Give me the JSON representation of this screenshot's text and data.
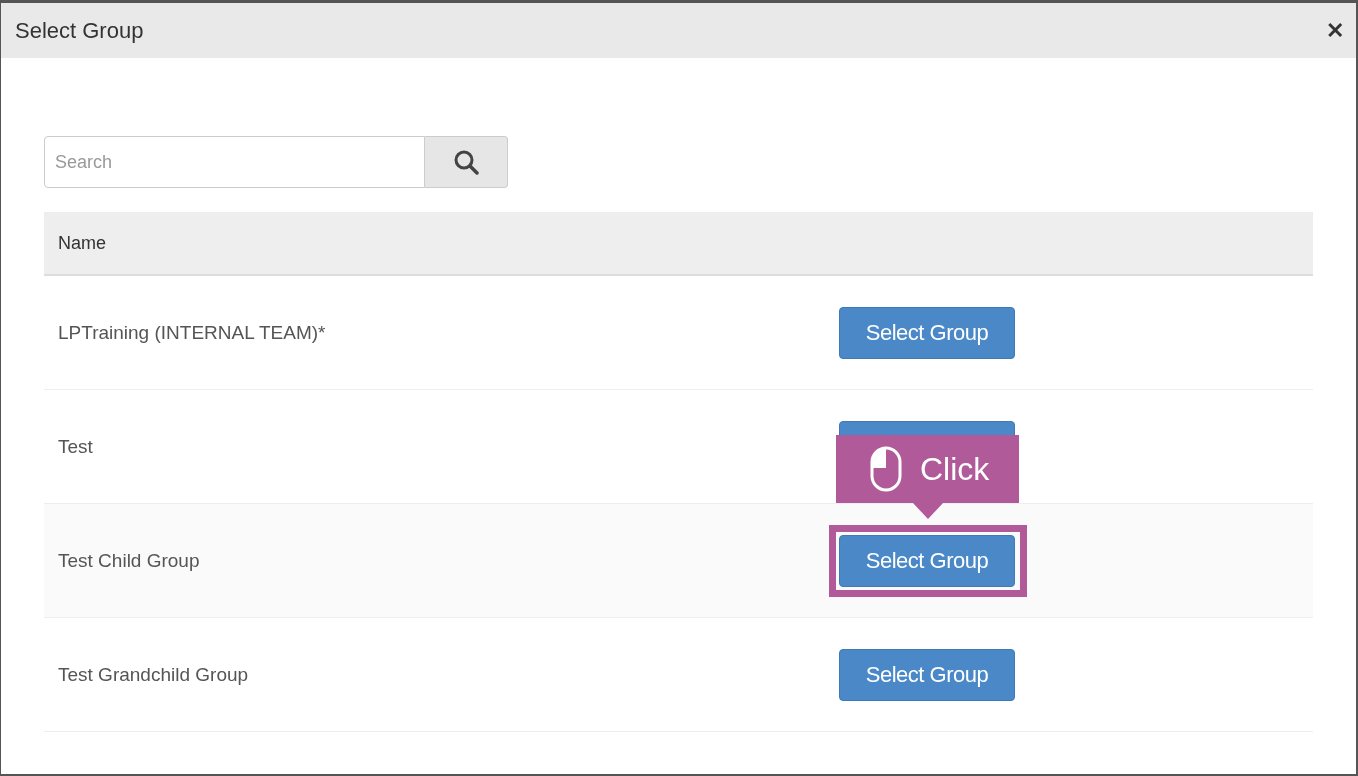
{
  "dialog": {
    "title": "Select Group",
    "close": "✕"
  },
  "search": {
    "placeholder": "Search"
  },
  "table": {
    "columns": [
      "Name"
    ],
    "rows": [
      {
        "name": "LPTraining (INTERNAL TEAM)*",
        "button": {
          "label": "Select Group"
        },
        "hovered": false,
        "highlighted": false
      },
      {
        "name": "Test",
        "button": {},
        "hovered": false,
        "highlighted": false
      },
      {
        "name": "Test Child Group",
        "button": {
          "label": "Select Group"
        },
        "hovered": true,
        "highlighted": true
      },
      {
        "name": "Test Grandchild Group",
        "button": {
          "label": "Select Group"
        },
        "hovered": false,
        "highlighted": false
      }
    ]
  },
  "callout": {
    "label": "Click"
  }
}
